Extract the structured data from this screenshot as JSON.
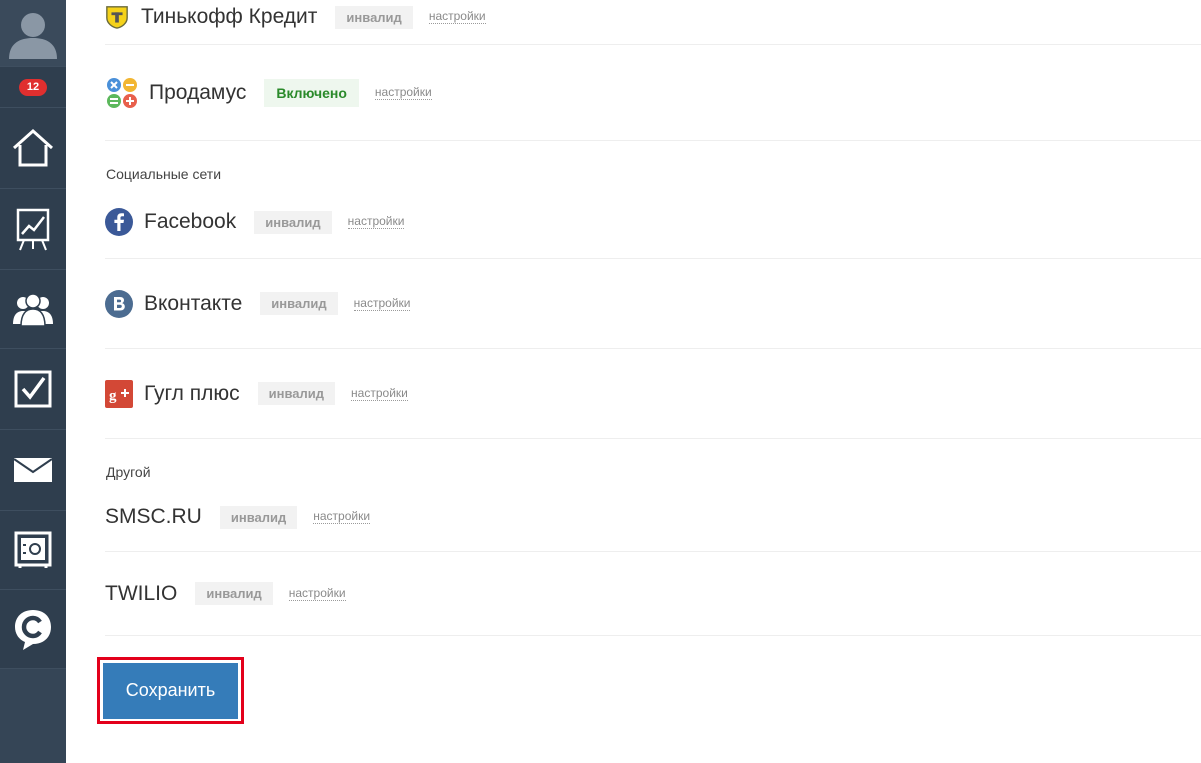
{
  "sidebar": {
    "badge_count": "12",
    "items": [
      "avatar",
      "notifications",
      "home",
      "analytics",
      "users",
      "tasks",
      "mail",
      "safe",
      "chat"
    ]
  },
  "sections": {
    "social": "Социальные сети",
    "other": "Другой"
  },
  "services": {
    "tinkoff": {
      "name": "Тинькофф Кредит",
      "status": "инвалид",
      "settings": "настройки"
    },
    "prodamus": {
      "name": "Продамус",
      "status": "Включено",
      "settings": "настройки"
    },
    "facebook": {
      "name": "Facebook",
      "status": "инвалид",
      "settings": "настройки"
    },
    "vkontakte": {
      "name": "Вконтакте",
      "status": "инвалид",
      "settings": "настройки"
    },
    "googleplus": {
      "name": "Гугл плюс",
      "status": "инвалид",
      "settings": "настройки"
    },
    "smsc": {
      "name": "SMSC.RU",
      "status": "инвалид",
      "settings": "настройки"
    },
    "twilio": {
      "name": "TWILIO",
      "status": "инвалид",
      "settings": "настройки"
    }
  },
  "save_button": {
    "label": "Сохранить"
  },
  "colors": {
    "sidebar": "#2f3e4e",
    "badge": "#e02f2f",
    "enabled_text": "#2a8a2a",
    "save_button": "#357cb9",
    "highlight_frame": "#e3001b"
  }
}
